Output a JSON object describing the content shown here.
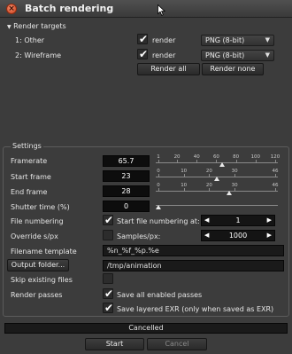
{
  "window": {
    "title": "Batch rendering",
    "close_glyph": "×"
  },
  "render_targets": {
    "header": "Render targets",
    "expander_glyph": "▼",
    "rows": [
      {
        "label": "1: Other",
        "checked": true,
        "render_label": "render",
        "format": "PNG (8-bit)"
      },
      {
        "label": "2: Wireframe",
        "checked": true,
        "render_label": "render",
        "format": "PNG (8-bit)"
      }
    ],
    "render_all": "Render all",
    "render_none": "Render none"
  },
  "settings": {
    "title": "Settings",
    "framerate": {
      "label": "Framerate",
      "value": "65.7",
      "ticks": [
        "1",
        "20",
        "40",
        "60",
        "80",
        "100",
        "120"
      ],
      "slider_value": 65.7,
      "range": [
        1,
        120
      ]
    },
    "start_frame": {
      "label": "Start frame",
      "value": "23",
      "ticks": [
        "0",
        "10",
        "20",
        "30",
        "46"
      ],
      "slider_value": 23,
      "range": [
        0,
        46
      ]
    },
    "end_frame": {
      "label": "End frame",
      "value": "28",
      "ticks": [
        "0",
        "10",
        "20",
        "30",
        "46"
      ],
      "slider_value": 28,
      "range": [
        0,
        46
      ]
    },
    "shutter_time": {
      "label": "Shutter time (%)",
      "value": "0",
      "slider_value": 0
    },
    "file_numbering": {
      "label": "File numbering",
      "checked": true,
      "check_label": "Start file numbering at:",
      "value": "1"
    },
    "override_spx": {
      "label": "Override s/px",
      "checked": false,
      "check_label": "Samples/px:",
      "value": "1000"
    },
    "filename_template": {
      "label": "Filename template",
      "value": "%n_%f_%p.%e"
    },
    "output_folder": {
      "button": "Output folder...",
      "value": "/tmp/animation"
    },
    "skip_existing": {
      "label": "Skip existing files",
      "checked": false
    },
    "render_passes": {
      "label": "Render passes",
      "checked": true,
      "check_label": "Save all enabled passes"
    },
    "save_layered": {
      "checked": true,
      "check_label": "Save layered EXR (only when saved as EXR)"
    }
  },
  "status": {
    "text": "Cancelled"
  },
  "actions": {
    "start": "Start",
    "cancel": "Cancel"
  },
  "glyphs": {
    "check": "✔",
    "dropdown_arrow": "▼",
    "spin_left": "◀",
    "spin_right": "▶"
  },
  "colors": {
    "close_button": "#d0441f",
    "background": "#3c3c3c",
    "field": "#0d0d0d"
  }
}
